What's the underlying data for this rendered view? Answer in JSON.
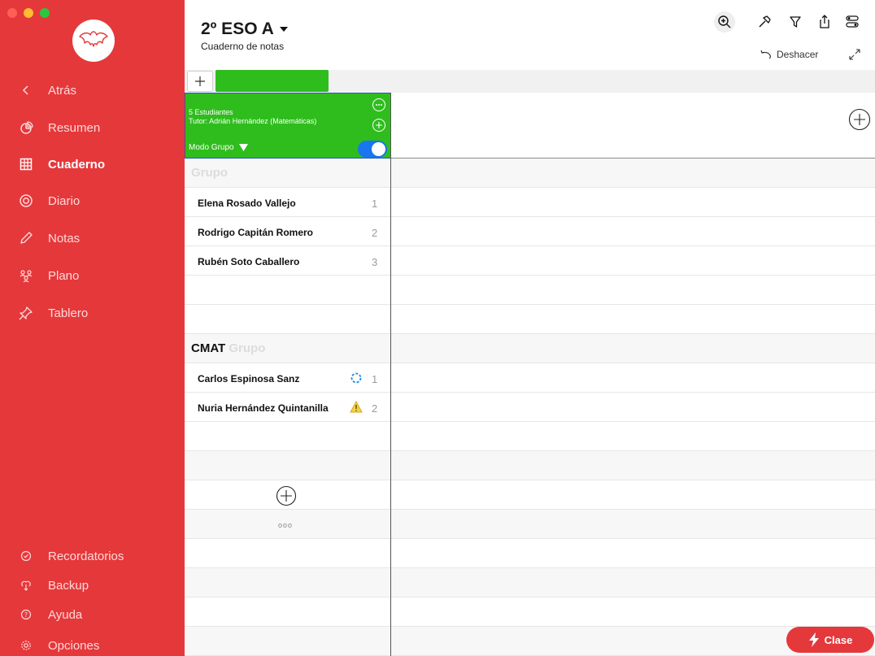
{
  "window": {
    "traffic_colors": [
      "#ff5f57",
      "#febc2e",
      "#28c840"
    ]
  },
  "colors": {
    "sidebar": "#e5383b",
    "accent_green": "#2fbd1d",
    "toggle_blue": "#1976f0"
  },
  "sidebar": {
    "logo_icon": "bat-icon",
    "nav": [
      {
        "label": "Atrás",
        "icon": "chevron-left-icon"
      },
      {
        "label": "Resumen",
        "icon": "pie-chart-icon"
      },
      {
        "label": "Cuaderno",
        "icon": "grid-icon"
      },
      {
        "label": "Diario",
        "icon": "target-icon"
      },
      {
        "label": "Notas",
        "icon": "pencil-icon"
      },
      {
        "label": "Plano",
        "icon": "people-icon"
      },
      {
        "label": "Tablero",
        "icon": "pin-icon"
      }
    ],
    "bottom": [
      {
        "label": "Recordatorios",
        "icon": "check-circle-icon"
      },
      {
        "label": "Backup",
        "icon": "cloud-icon"
      },
      {
        "label": "Ayuda",
        "icon": "help-icon"
      },
      {
        "label": "Opciones",
        "icon": "gear-icon"
      }
    ]
  },
  "header": {
    "title": "2º ESO A",
    "subtitle": "Cuaderno de notas",
    "undo_label": "Deshacer"
  },
  "card": {
    "students": "5 Estudiantes",
    "tutor": "Tutor: Adrián Hernández (Matemáticas)",
    "mode_label": "Modo Grupo"
  },
  "groups": [
    {
      "prefix": "",
      "label": "Grupo",
      "students": [
        {
          "name": "Elena Rosado Vallejo",
          "num": "1",
          "status": ""
        },
        {
          "name": "Rodrigo Capitán Romero",
          "num": "2",
          "status": ""
        },
        {
          "name": "Rubén Soto Caballero",
          "num": "3",
          "status": ""
        }
      ]
    },
    {
      "prefix": "CMAT",
      "label": "Grupo",
      "students": [
        {
          "name": "Carlos Espinosa Sanz",
          "num": "1",
          "status": "sync-icon"
        },
        {
          "name": "Nuria Hernández Quintanilla",
          "num": "2",
          "status": "warning-icon"
        }
      ]
    }
  ],
  "list_more": "ooo",
  "clase_button": "Clase"
}
